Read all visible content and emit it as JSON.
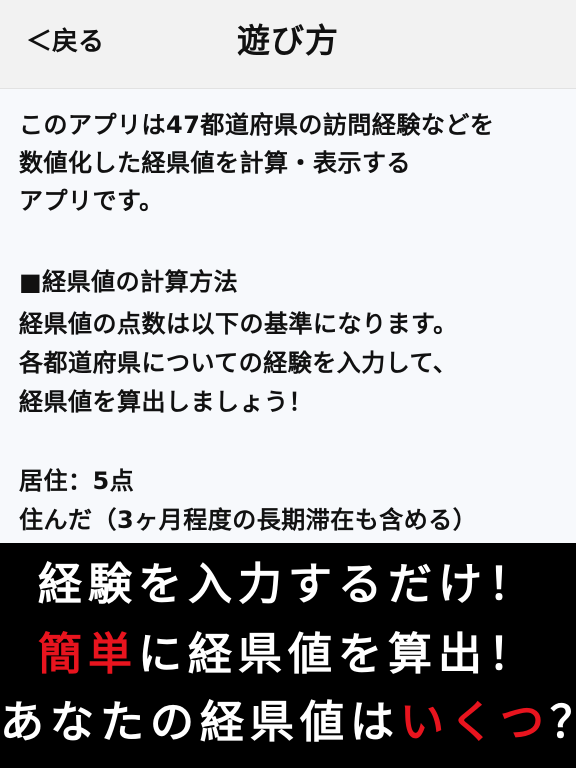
{
  "header": {
    "back_label": "＜戻る",
    "title": "遊び方"
  },
  "body": {
    "lines": [
      "このアプリは47都道府県の訪問経験などを",
      "数値化した経県値を計算・表示する",
      "アプリです。",
      "",
      "■経県値の計算方法",
      "経県値の点数は以下の基準になります。",
      "各都道府県についての経験を入力して、",
      "経県値を算出しましょう！",
      "",
      "居住：5点",
      "住んだ（3ヶ月程度の長期滞在も含める）"
    ]
  },
  "banner": {
    "line1": "経験を入力するだけ！",
    "line2_red": "簡単",
    "line2_rest": "に経県値を算出！",
    "line3_start": "あなたの経県値は",
    "line3_red": "いくつ",
    "line3_end": "？",
    "accent_color": "#e8141e"
  }
}
